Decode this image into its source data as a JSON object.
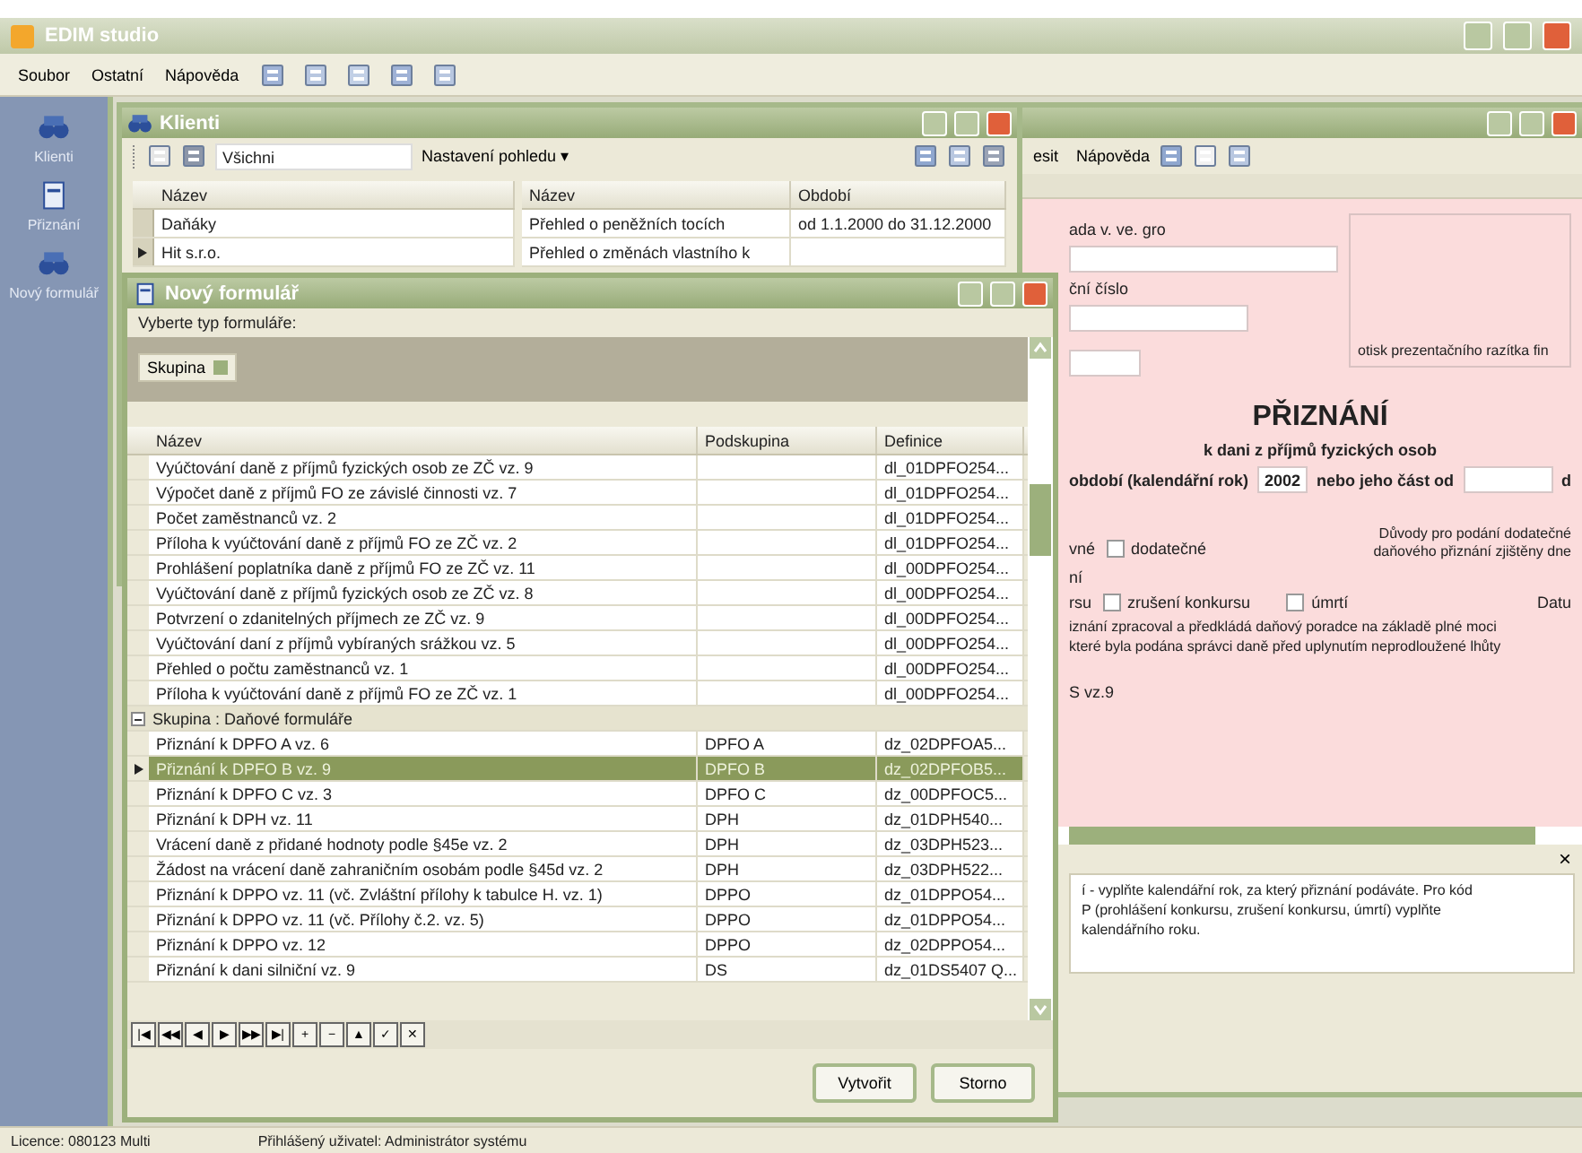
{
  "app": {
    "title": "EDIM studio"
  },
  "menu": [
    {
      "label": "Soubor"
    },
    {
      "label": "Ostatní"
    },
    {
      "label": "Nápověda"
    }
  ],
  "sidebar": {
    "items": [
      {
        "label": "Klienti",
        "kind": "binoculars"
      },
      {
        "label": "Přiznání",
        "kind": "document"
      },
      {
        "label": "Nový formulář",
        "kind": "binoculars"
      }
    ]
  },
  "clients_window": {
    "title": "Klienti",
    "filter": "Všichni",
    "view_button": "Nastavení pohledu ▾",
    "clients": {
      "column": "Název",
      "rows": [
        {
          "name": "Daňáky",
          "current": false
        },
        {
          "name": "Hit s.r.o.",
          "current": true
        }
      ]
    },
    "forms": {
      "columns": [
        "Název",
        "Období"
      ],
      "rows": [
        {
          "name": "Přehled o peněžních tocích",
          "period": "od 1.1.2000 do 31.12.2000"
        },
        {
          "name": "Přehled o změnách vlastního k"
        }
      ]
    }
  },
  "form_window": {
    "menu": [
      "esit",
      "Nápověda"
    ],
    "labels": [
      "ada v. ve. gro",
      "ční číslo"
    ],
    "stamp": "otisk prezentačního razítka fin",
    "heading": "PŘIZNÁNÍ",
    "subheading": "k dani z příjmů fyzických osob",
    "period_label": "období (kalendářní rok)",
    "year": "2002",
    "part_label": "nebo jeho část od",
    "part_tail": "d",
    "reasons": [
      "Důvody pro podání dodatečné",
      "daňového přiznání zjištěny dne"
    ],
    "type_prefix": "vné",
    "type_line2": "ní",
    "reason_prefix": "rsu",
    "date_label": "Datu",
    "checks": [
      {
        "label": "dodatečné",
        "checked": false
      },
      {
        "label": "zrušení konkursu",
        "checked": false
      },
      {
        "label": "úmrtí",
        "checked": false
      }
    ],
    "advisor": [
      "iznání zpracoval a předkládá daňový poradce na základě plné moci",
      "které byla podána správci daně před uplynutím neprodloužené lhůty"
    ],
    "version": "S vz.9",
    "help": [
      "í - vyplňte kalendářní rok, za který přiznání podáváte. Pro kód",
      "P (prohlášení konkursu, zrušení konkursu, úmrtí) vyplňte",
      "kalendářního roku."
    ],
    "help_close": "×"
  },
  "dialog": {
    "title": "Nový formulář",
    "prompt": "Vyberte typ formuláře:",
    "group_by": "Skupina",
    "columns": [
      "Název",
      "Podskupina",
      "Definice"
    ],
    "rows": [
      {
        "kind": "row",
        "name": "Vyúčtování daně z příjmů fyzických osob ze ZČ vz. 9",
        "definition": "dl_01DPFO254...",
        "selected": false
      },
      {
        "kind": "row",
        "name": "Výpočet daně z příjmů FO ze závislé činnosti vz. 7",
        "definition": "dl_01DPFO254...",
        "selected": false
      },
      {
        "kind": "row",
        "name": "Počet zaměstnanců vz. 2",
        "definition": "dl_01DPFO254...",
        "selected": false
      },
      {
        "kind": "row",
        "name": "Příloha k vyúčtování daně z příjmů FO ze ZČ vz. 2",
        "definition": "dl_01DPFO254...",
        "selected": false
      },
      {
        "kind": "row",
        "name": "Prohlášení poplatníka daně z příjmů FO ze ZČ vz. 11",
        "definition": "dl_00DPFO254...",
        "selected": false
      },
      {
        "kind": "row",
        "name": "Vyúčtování daně z příjmů fyzických osob ze ZČ vz. 8",
        "definition": "dl_00DPFO254...",
        "selected": false
      },
      {
        "kind": "row",
        "name": "Potvrzení o zdanitelných příjmech ze ZČ vz. 9",
        "definition": "dl_00DPFO254...",
        "selected": false
      },
      {
        "kind": "row",
        "name": "Vyúčtování daní z příjmů vybíraných srážkou vz. 5",
        "definition": "dl_00DPFO254...",
        "selected": false
      },
      {
        "kind": "row",
        "name": "Přehled o počtu zaměstnanců vz. 1",
        "definition": "dl_00DPFO254...",
        "selected": false
      },
      {
        "kind": "row",
        "name": "Příloha k vyúčtování daně z příjmů FO ze ZČ vz. 1",
        "definition": "dl_00DPFO254...",
        "selected": false
      },
      {
        "kind": "group",
        "label": "Skupina : Daňové formuláře",
        "expanded": true
      },
      {
        "kind": "row",
        "name": "Přiznání k DPFO A vz. 6",
        "subgroup": "DPFO A",
        "definition": "dz_02DPFOA5...",
        "selected": false
      },
      {
        "kind": "row",
        "name": "Přiznání k DPFO B vz. 9",
        "subgroup": "DPFO B",
        "definition": "dz_02DPFOB5...",
        "selected": true
      },
      {
        "kind": "row",
        "name": "Přiznání k DPFO C vz. 3",
        "subgroup": "DPFO C",
        "definition": "dz_00DPFOC5...",
        "selected": false
      },
      {
        "kind": "row",
        "name": "Přiznání k DPH vz. 11",
        "subgroup": "DPH",
        "definition": "dz_01DPH540...",
        "selected": false
      },
      {
        "kind": "row",
        "name": "Vrácení daně z přidané hodnoty podle §45e vz. 2",
        "subgroup": "DPH",
        "definition": "dz_03DPH523...",
        "selected": false
      },
      {
        "kind": "row",
        "name": "Žádost na vrácení daně zahraničním osobám podle §45d vz. 2",
        "subgroup": "DPH",
        "definition": "dz_03DPH522...",
        "selected": false
      },
      {
        "kind": "row",
        "name": "Přiznání k DPPO vz. 11 (vč. Zvláštní přílohy k tabulce H. vz. 1)",
        "subgroup": "DPPO",
        "definition": "dz_01DPPO54...",
        "selected": false
      },
      {
        "kind": "row",
        "name": "Přiznání k DPPO vz. 11 (vč. Přílohy č.2. vz. 5)",
        "subgroup": "DPPO",
        "definition": "dz_01DPPO54...",
        "selected": false
      },
      {
        "kind": "row",
        "name": "Přiznání k DPPO vz. 12",
        "subgroup": "DPPO",
        "definition": "dz_02DPPO54...",
        "selected": false
      },
      {
        "kind": "row",
        "name": "Přiznání k dani silniční vz. 9",
        "subgroup": "DS",
        "definition": "dz_01DS5407 Q...",
        "selected": false
      }
    ],
    "navigator": [
      "|◀",
      "◀◀",
      "◀",
      "▶",
      "▶▶",
      "▶|",
      "+",
      "−",
      "▲",
      "✓",
      "✕"
    ],
    "buttons": [
      "Vytvořit",
      "Storno"
    ]
  },
  "status_bar": [
    "Licence: 080123 Multi",
    "Přihlášený uživatel: Administrátor systému"
  ]
}
